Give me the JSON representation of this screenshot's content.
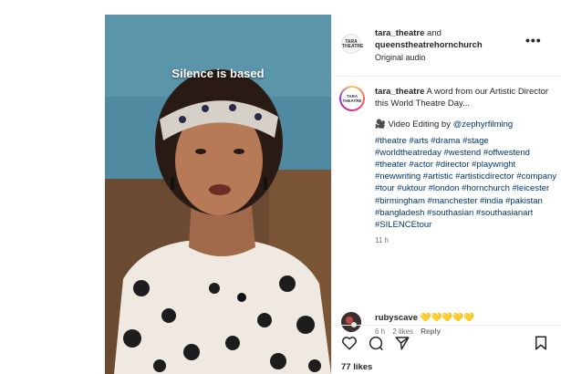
{
  "video": {
    "caption_overlay": "Silence is based"
  },
  "post": {
    "header": {
      "account1": "tara_theatre",
      "and_text": "and",
      "account2": "queenstheatrehornchurch",
      "audio": "Original audio",
      "logo_text": "TARA THEATRE",
      "more_label": "•••"
    },
    "caption": {
      "username": "tara_theatre",
      "text": "A word from our Artistic Director this World Theatre Day...",
      "editing_prefix": "🎥 Video Editing by ",
      "editing_handle": "@zephyrfilming",
      "hashtags": "#theatre #arts #drama #stage #worldtheatreday #westend #offwestend #theater #actor #director #playwright #newwriting #artistic #artisticdirector #company #tour #uktour #london #hornchurch #leicester #birmingham #manchester #india #pakistan #bangladesh #southasian #southasianart #SILENCEtour",
      "time": "11 h",
      "avatar_text": "TARA THEATRE"
    },
    "comment": {
      "username": "rubyscave",
      "text": "💛💛💛💛💛",
      "time": "6 h",
      "likes": "2 likes",
      "reply": "Reply"
    },
    "likes": "77 likes"
  },
  "icons": {
    "like": "heart-icon",
    "comment": "comment-icon",
    "share": "send-icon",
    "save": "bookmark-icon"
  }
}
